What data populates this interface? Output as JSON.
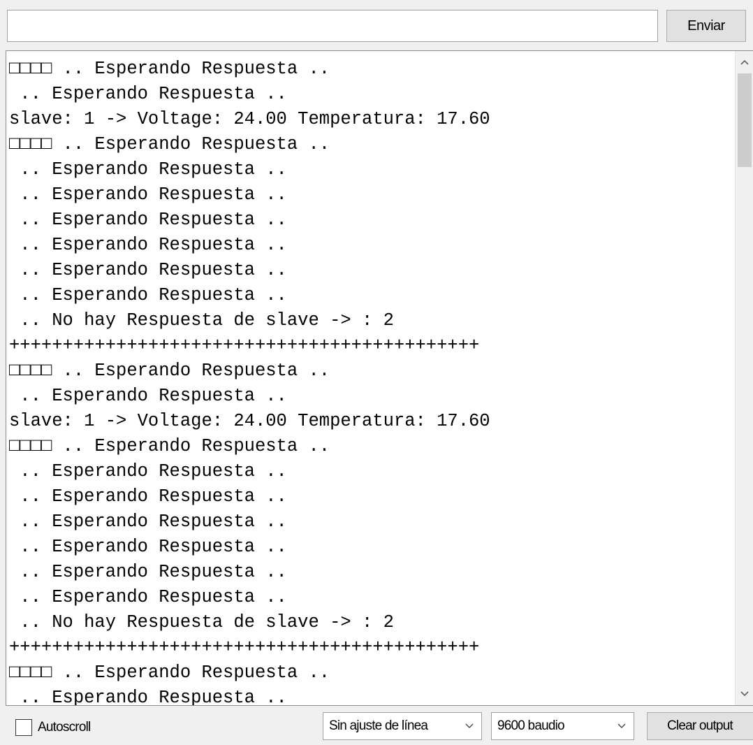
{
  "send_bar": {
    "input_value": "",
    "send_label": "Enviar"
  },
  "output": {
    "lines": [
      "□□□□ .. Esperando Respuesta ..",
      " .. Esperando Respuesta ..",
      "slave: 1 -> Voltage: 24.00 Temperatura: 17.60",
      "□□□□ .. Esperando Respuesta ..",
      " .. Esperando Respuesta ..",
      " .. Esperando Respuesta ..",
      " .. Esperando Respuesta ..",
      " .. Esperando Respuesta ..",
      " .. Esperando Respuesta ..",
      " .. Esperando Respuesta ..",
      " .. No hay Respuesta de slave -> : 2",
      "++++++++++++++++++++++++++++++++++++++++++++",
      "□□□□ .. Esperando Respuesta ..",
      " .. Esperando Respuesta ..",
      "slave: 1 -> Voltage: 24.00 Temperatura: 17.60",
      "□□□□ .. Esperando Respuesta ..",
      " .. Esperando Respuesta ..",
      " .. Esperando Respuesta ..",
      " .. Esperando Respuesta ..",
      " .. Esperando Respuesta ..",
      " .. Esperando Respuesta ..",
      " .. Esperando Respuesta ..",
      " .. No hay Respuesta de slave -> : 2",
      "++++++++++++++++++++++++++++++++++++++++++++",
      "□□□□ .. Esperando Respuesta ..",
      " .. Esperando Respuesta .."
    ]
  },
  "bottom_bar": {
    "autoscroll_label": "Autoscroll",
    "autoscroll_checked": false,
    "line_ending_value": "Sin ajuste de línea",
    "baud_value": "9600 baudio",
    "clear_label": "Clear output"
  },
  "colors": {
    "window_bg": "#f0f0f0",
    "output_bg": "#ffffff",
    "button_bg": "#e1e1e1",
    "scroll_thumb": "#cdcdcd"
  },
  "icons": {
    "scroll_up": "chevron-up-icon",
    "scroll_down": "chevron-down-icon",
    "dropdown": "chevron-down-icon"
  }
}
